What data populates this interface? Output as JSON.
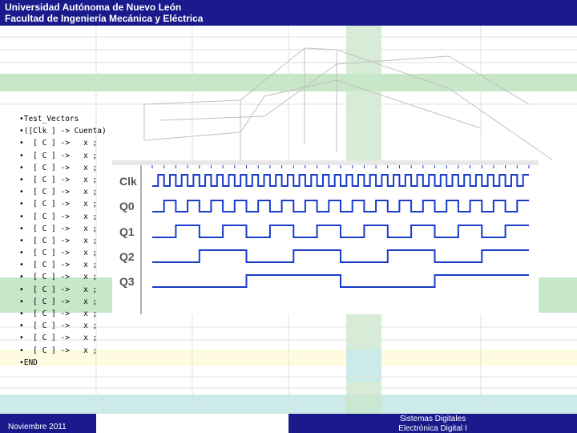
{
  "header": {
    "line1": "Universidad Autónoma de Nuevo León",
    "line2": "Facultad de Ingeniería Mecánica y Eléctrica"
  },
  "code": {
    "lines": [
      "•Test_Vectors",
      "•([Clk ] -> Cuenta)",
      "•  [ C ] ->   x ;",
      "•  [ C ] ->   x ;",
      "•  [ C ] ->   x ;",
      "•  [ C ] ->   x ;",
      "•  [ C ] ->   x ;",
      "•  [ C ] ->   x ;",
      "•  [ C ] ->   x ;",
      "•  [ C ] ->   x ;",
      "•  [ C ] ->   x ;",
      "•  [ C ] ->   x ;",
      "•  [ C ] ->   x ;",
      "•  [ C ] ->   x ;",
      "•  [ C ] ->   x ;",
      "•  [ C ] ->   x ;",
      "•  [ C ] ->   x ;",
      "•  [ C ] ->   x ;",
      "•  [ C ] ->   x ;",
      "•  [ C ] ->   x ;",
      "•END"
    ]
  },
  "waveform": {
    "signals": [
      "Clk",
      "Q0",
      "Q1",
      "Q2",
      "Q3"
    ]
  },
  "footer": {
    "date": "Noviembre 2011",
    "title1": "Sistemas Digitales",
    "title2": "Electrónica Digital I"
  },
  "colors": {
    "header_bg": "#1a1a8c",
    "wave_blue": "#1a3cc8",
    "green_band": "#c8e6c8",
    "yellow_band": "#fffbe0",
    "cyan_band": "#cdeaea"
  }
}
